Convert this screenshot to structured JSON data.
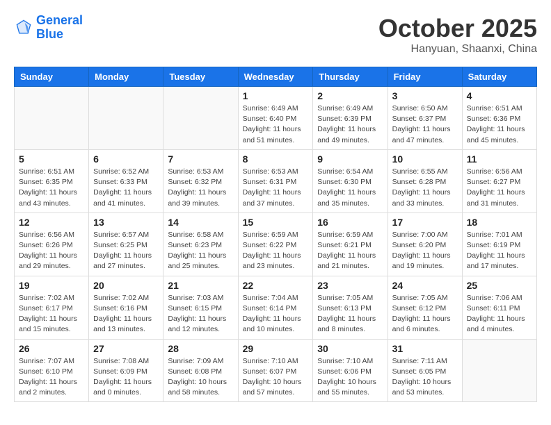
{
  "logo": {
    "line1": "General",
    "line2": "Blue"
  },
  "title": "October 2025",
  "location": "Hanyuan, Shaanxi, China",
  "weekdays": [
    "Sunday",
    "Monday",
    "Tuesday",
    "Wednesday",
    "Thursday",
    "Friday",
    "Saturday"
  ],
  "weeks": [
    [
      {
        "day": "",
        "info": ""
      },
      {
        "day": "",
        "info": ""
      },
      {
        "day": "",
        "info": ""
      },
      {
        "day": "1",
        "info": "Sunrise: 6:49 AM\nSunset: 6:40 PM\nDaylight: 11 hours\nand 51 minutes."
      },
      {
        "day": "2",
        "info": "Sunrise: 6:49 AM\nSunset: 6:39 PM\nDaylight: 11 hours\nand 49 minutes."
      },
      {
        "day": "3",
        "info": "Sunrise: 6:50 AM\nSunset: 6:37 PM\nDaylight: 11 hours\nand 47 minutes."
      },
      {
        "day": "4",
        "info": "Sunrise: 6:51 AM\nSunset: 6:36 PM\nDaylight: 11 hours\nand 45 minutes."
      }
    ],
    [
      {
        "day": "5",
        "info": "Sunrise: 6:51 AM\nSunset: 6:35 PM\nDaylight: 11 hours\nand 43 minutes."
      },
      {
        "day": "6",
        "info": "Sunrise: 6:52 AM\nSunset: 6:33 PM\nDaylight: 11 hours\nand 41 minutes."
      },
      {
        "day": "7",
        "info": "Sunrise: 6:53 AM\nSunset: 6:32 PM\nDaylight: 11 hours\nand 39 minutes."
      },
      {
        "day": "8",
        "info": "Sunrise: 6:53 AM\nSunset: 6:31 PM\nDaylight: 11 hours\nand 37 minutes."
      },
      {
        "day": "9",
        "info": "Sunrise: 6:54 AM\nSunset: 6:30 PM\nDaylight: 11 hours\nand 35 minutes."
      },
      {
        "day": "10",
        "info": "Sunrise: 6:55 AM\nSunset: 6:28 PM\nDaylight: 11 hours\nand 33 minutes."
      },
      {
        "day": "11",
        "info": "Sunrise: 6:56 AM\nSunset: 6:27 PM\nDaylight: 11 hours\nand 31 minutes."
      }
    ],
    [
      {
        "day": "12",
        "info": "Sunrise: 6:56 AM\nSunset: 6:26 PM\nDaylight: 11 hours\nand 29 minutes."
      },
      {
        "day": "13",
        "info": "Sunrise: 6:57 AM\nSunset: 6:25 PM\nDaylight: 11 hours\nand 27 minutes."
      },
      {
        "day": "14",
        "info": "Sunrise: 6:58 AM\nSunset: 6:23 PM\nDaylight: 11 hours\nand 25 minutes."
      },
      {
        "day": "15",
        "info": "Sunrise: 6:59 AM\nSunset: 6:22 PM\nDaylight: 11 hours\nand 23 minutes."
      },
      {
        "day": "16",
        "info": "Sunrise: 6:59 AM\nSunset: 6:21 PM\nDaylight: 11 hours\nand 21 minutes."
      },
      {
        "day": "17",
        "info": "Sunrise: 7:00 AM\nSunset: 6:20 PM\nDaylight: 11 hours\nand 19 minutes."
      },
      {
        "day": "18",
        "info": "Sunrise: 7:01 AM\nSunset: 6:19 PM\nDaylight: 11 hours\nand 17 minutes."
      }
    ],
    [
      {
        "day": "19",
        "info": "Sunrise: 7:02 AM\nSunset: 6:17 PM\nDaylight: 11 hours\nand 15 minutes."
      },
      {
        "day": "20",
        "info": "Sunrise: 7:02 AM\nSunset: 6:16 PM\nDaylight: 11 hours\nand 13 minutes."
      },
      {
        "day": "21",
        "info": "Sunrise: 7:03 AM\nSunset: 6:15 PM\nDaylight: 11 hours\nand 12 minutes."
      },
      {
        "day": "22",
        "info": "Sunrise: 7:04 AM\nSunset: 6:14 PM\nDaylight: 11 hours\nand 10 minutes."
      },
      {
        "day": "23",
        "info": "Sunrise: 7:05 AM\nSunset: 6:13 PM\nDaylight: 11 hours\nand 8 minutes."
      },
      {
        "day": "24",
        "info": "Sunrise: 7:05 AM\nSunset: 6:12 PM\nDaylight: 11 hours\nand 6 minutes."
      },
      {
        "day": "25",
        "info": "Sunrise: 7:06 AM\nSunset: 6:11 PM\nDaylight: 11 hours\nand 4 minutes."
      }
    ],
    [
      {
        "day": "26",
        "info": "Sunrise: 7:07 AM\nSunset: 6:10 PM\nDaylight: 11 hours\nand 2 minutes."
      },
      {
        "day": "27",
        "info": "Sunrise: 7:08 AM\nSunset: 6:09 PM\nDaylight: 11 hours\nand 0 minutes."
      },
      {
        "day": "28",
        "info": "Sunrise: 7:09 AM\nSunset: 6:08 PM\nDaylight: 10 hours\nand 58 minutes."
      },
      {
        "day": "29",
        "info": "Sunrise: 7:10 AM\nSunset: 6:07 PM\nDaylight: 10 hours\nand 57 minutes."
      },
      {
        "day": "30",
        "info": "Sunrise: 7:10 AM\nSunset: 6:06 PM\nDaylight: 10 hours\nand 55 minutes."
      },
      {
        "day": "31",
        "info": "Sunrise: 7:11 AM\nSunset: 6:05 PM\nDaylight: 10 hours\nand 53 minutes."
      },
      {
        "day": "",
        "info": ""
      }
    ]
  ]
}
